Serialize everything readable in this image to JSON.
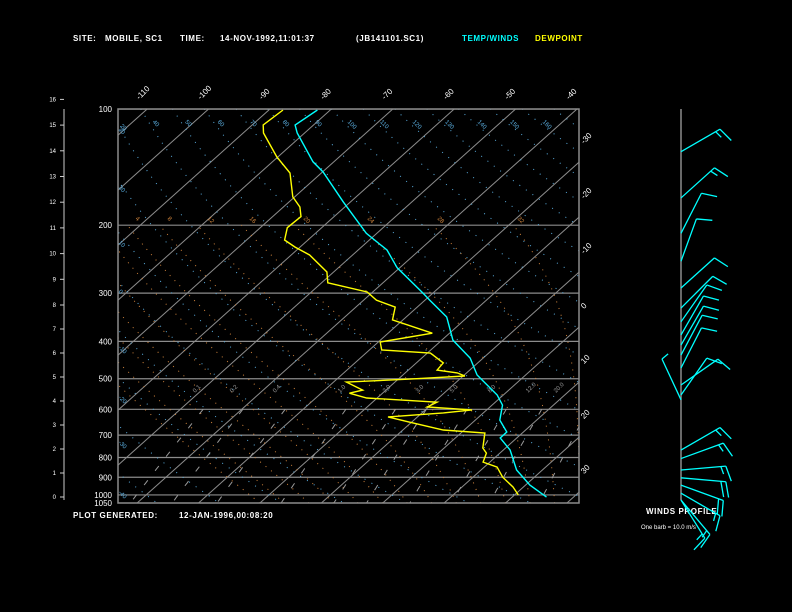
{
  "header": {
    "site_label": "SITE:",
    "site": "MOBILE, SC1",
    "time_label": "TIME:",
    "time": "14-NOV-1992,11:01:37",
    "file": "(JB141101.SC1)",
    "legend_temp": "TEMP/WINDS",
    "legend_dew": "DEWPOINT"
  },
  "footer": {
    "generated_label": "PLOT GENERATED:",
    "generated_time": "12-JAN-1996,00:08:20"
  },
  "winds_panel": {
    "title": "WINDS PROFILE",
    "note": "One barb = 10.0 m/s"
  },
  "colors": {
    "temp": "#00ffff",
    "dewpoint": "#ffff00",
    "grid": "#8c8c8c",
    "dry_adiabat": "#5aaee0",
    "moist_adiabat": "#d0843c",
    "mixing_ratio": "#9a9a9a"
  },
  "chart_data": {
    "type": "line",
    "pressure_levels": [
      100,
      200,
      300,
      400,
      500,
      600,
      700,
      800,
      900,
      1000,
      1050
    ],
    "pressure_labels": [
      "100",
      "200",
      "300",
      "400",
      "500",
      "600",
      "700",
      "800",
      "900",
      "1000",
      "1050"
    ],
    "height_km_ticks": [
      "0",
      "1",
      "2",
      "3",
      "4",
      "5",
      "6",
      "7",
      "8",
      "9",
      "10",
      "11",
      "12",
      "13",
      "14",
      "15",
      "16"
    ],
    "isotherm_top_labels": [
      "-110",
      "-100",
      "-90",
      "-80",
      "-70",
      "-60",
      "-50",
      "-40"
    ],
    "isotherm_top_values": [
      -110,
      -100,
      -90,
      -80,
      -70,
      -60,
      -50,
      -40
    ],
    "isotherm_right_labels": [
      "-30",
      "-20",
      "-10",
      "0",
      "10",
      "20",
      "30"
    ],
    "isotherm_right_values": [
      -30,
      -20,
      -10,
      0,
      10,
      20,
      30
    ],
    "dry_adiabat_labels": [
      "20",
      "40",
      "50",
      "60",
      "70",
      "80",
      "90",
      "100",
      "110",
      "120",
      "130",
      "140",
      "150",
      "160"
    ],
    "dry_adiabat_left_labels": [
      "20",
      "30",
      "10",
      "0",
      "-10",
      "-20",
      "-30",
      "-40"
    ],
    "moist_adiabat_labels": [
      "4",
      "8",
      "12",
      "16",
      "20",
      "24",
      "28",
      "32"
    ],
    "mixing_ratio_labels": [
      "0.1",
      "0.2",
      "0.4",
      "1.0",
      "2.0",
      "3.0",
      "5.0",
      "8.0",
      "12.0",
      "20.0"
    ],
    "mixing_ratio_values": [
      0.1,
      0.2,
      0.4,
      1.0,
      2.0,
      3.0,
      5.0,
      8.0,
      12.0,
      20.0
    ],
    "series": [
      {
        "name": "TEMP/WINDS",
        "points_p_T": [
          [
            100.6,
            -82.1
          ],
          [
            110,
            -83.0
          ],
          [
            115.4,
            -81.2
          ],
          [
            137,
            -73.4
          ],
          [
            145.6,
            -69.9
          ],
          [
            174,
            -61.2
          ],
          [
            210,
            -51.7
          ],
          [
            232,
            -45.3
          ],
          [
            258,
            -40.4
          ],
          [
            300,
            -31.6
          ],
          [
            313,
            -29.2
          ],
          [
            346,
            -23.4
          ],
          [
            397,
            -18.2
          ],
          [
            442,
            -12.1
          ],
          [
            489,
            -7.9
          ],
          [
            551,
            -1.0
          ],
          [
            585,
            1.7
          ],
          [
            640,
            4.0
          ],
          [
            687,
            7.3
          ],
          [
            712,
            7.3
          ],
          [
            765,
            11.1
          ],
          [
            862,
            15.8
          ],
          [
            943,
            20.7
          ],
          [
            1013,
            25.6
          ]
        ]
      },
      {
        "name": "DEWPOINT",
        "points_p_T": [
          [
            100.6,
            -87.7
          ],
          [
            110,
            -88.2
          ],
          [
            115.4,
            -86.7
          ],
          [
            133,
            -80.2
          ],
          [
            146.5,
            -75.1
          ],
          [
            169,
            -70.3
          ],
          [
            179.5,
            -67.3
          ],
          [
            190,
            -65.4
          ],
          [
            203,
            -65.6
          ],
          [
            218.5,
            -63.8
          ],
          [
            228,
            -60.8
          ],
          [
            239,
            -57.0
          ],
          [
            264.5,
            -51.1
          ],
          [
            282,
            -49.0
          ],
          [
            298,
            -40.9
          ],
          [
            313,
            -37.9
          ],
          [
            326,
            -33.6
          ],
          [
            352,
            -31.7
          ],
          [
            381,
            -22.8
          ],
          [
            401.5,
            -29.7
          ],
          [
            421,
            -28.0
          ],
          [
            429,
            -19.5
          ],
          [
            455,
            -15.6
          ],
          [
            475,
            -15.3
          ],
          [
            483,
            -11.5
          ],
          [
            492,
            -9.7
          ],
          [
            501,
            -18.1
          ],
          [
            510,
            -27.9
          ],
          [
            535,
            -23.8
          ],
          [
            545,
            -25.4
          ],
          [
            561,
            -21.7
          ],
          [
            575,
            -9.5
          ],
          [
            592,
            -10.2
          ],
          [
            602,
            -2.4
          ],
          [
            613,
            -6.5
          ],
          [
            628,
            -14.8
          ],
          [
            648,
            -10.3
          ],
          [
            679,
            -3.4
          ],
          [
            691,
            3.9
          ],
          [
            756,
            6.3
          ],
          [
            779,
            7.8
          ],
          [
            822,
            8.9
          ],
          [
            847,
            12.1
          ],
          [
            899,
            14.8
          ],
          [
            954,
            18.3
          ],
          [
            1000,
            20.6
          ]
        ]
      }
    ],
    "winds": [
      {
        "p": 129,
        "dir": 60,
        "speed": 15
      },
      {
        "p": 170,
        "dir": 48,
        "speed": 15
      },
      {
        "p": 210,
        "dir": 27,
        "speed": 10
      },
      {
        "p": 248,
        "dir": 20,
        "speed": 10
      },
      {
        "p": 291,
        "dir": 48,
        "speed": 10
      },
      {
        "p": 328,
        "dir": 45,
        "speed": 10
      },
      {
        "p": 356,
        "dir": 35,
        "speed": 10
      },
      {
        "p": 385,
        "dir": 30,
        "speed": 10
      },
      {
        "p": 409,
        "dir": 30,
        "speed": 10
      },
      {
        "p": 434,
        "dir": 28,
        "speed": 10
      },
      {
        "p": 469,
        "dir": 27,
        "speed": 10
      },
      {
        "p": 519,
        "dir": 55,
        "speed": 10
      },
      {
        "p": 551,
        "dir": 35,
        "speed": 10
      },
      {
        "p": 567,
        "dir": 335,
        "speed": 5
      },
      {
        "p": 765,
        "dir": 60,
        "speed": 15
      },
      {
        "p": 805,
        "dir": 70,
        "speed": 15
      },
      {
        "p": 862,
        "dir": 85,
        "speed": 15
      },
      {
        "p": 903,
        "dir": 95,
        "speed": 20
      },
      {
        "p": 943,
        "dir": 110,
        "speed": 20
      },
      {
        "p": 990,
        "dir": 120,
        "speed": 15
      },
      {
        "p": 1034,
        "dir": 140,
        "speed": 15
      },
      {
        "p": 1050,
        "dir": 148,
        "speed": 15
      }
    ]
  }
}
